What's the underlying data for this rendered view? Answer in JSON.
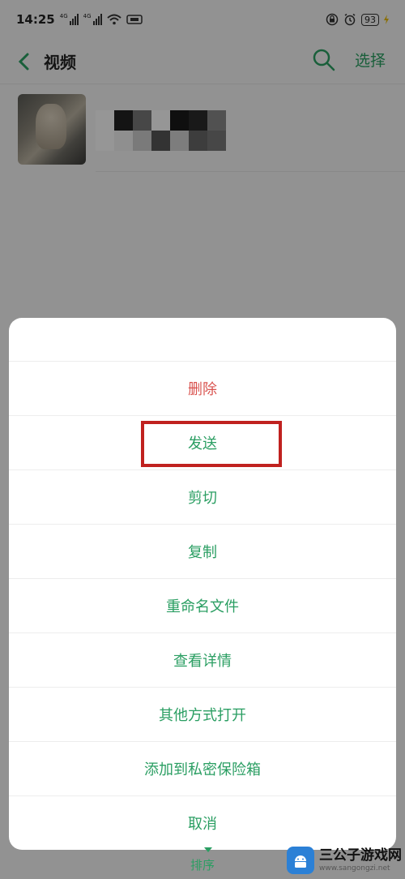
{
  "status_bar": {
    "time": "14:25",
    "network_labels": [
      "4G",
      "4G"
    ],
    "battery": "93"
  },
  "header": {
    "title": "视频",
    "select_label": "选择"
  },
  "mosaic_colors": [
    "#fafafa",
    "#222222",
    "#777777",
    "#fafafa",
    "#1a1a1a",
    "#2a2a2a",
    "#888888",
    "#fafafa",
    "#eeeeee",
    "#cccccc",
    "#555555",
    "#d0d0d0",
    "#666666",
    "#777777"
  ],
  "action_sheet": {
    "items": [
      {
        "label": "删除",
        "danger": true
      },
      {
        "label": "发送",
        "danger": false
      },
      {
        "label": "剪切",
        "danger": false
      },
      {
        "label": "复制",
        "danger": false
      },
      {
        "label": "重命名文件",
        "danger": false
      },
      {
        "label": "查看详情",
        "danger": false
      },
      {
        "label": "其他方式打开",
        "danger": false
      },
      {
        "label": "添加到私密保险箱",
        "danger": false
      },
      {
        "label": "取消",
        "danger": false
      }
    ]
  },
  "bottom_bar": {
    "sort_label": "排序"
  },
  "watermark": {
    "title": "三公子游戏网",
    "url": "www.sangongzi.net"
  },
  "colors": {
    "accent": "#2a9e62",
    "danger": "#d9534f",
    "highlight": "#c0211f"
  }
}
